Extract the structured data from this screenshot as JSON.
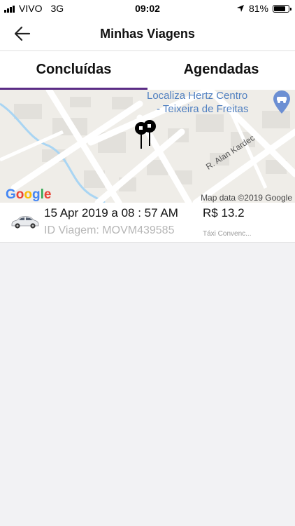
{
  "status_bar": {
    "carrier": "VIVO",
    "network": "3G",
    "time": "09:02",
    "battery": "81%",
    "battery_level": 0.81
  },
  "header": {
    "title": "Minhas Viagens"
  },
  "tabs": [
    {
      "label": "Concluídas",
      "active": true
    },
    {
      "label": "Agendadas",
      "active": false
    }
  ],
  "map": {
    "poi_line1": "Localiza Hertz Centro",
    "poi_line2": "- Teixeira de Freitas",
    "street": "R. Alan Kardec",
    "attribution": "Map data ©2019 Google",
    "logo": "Google"
  },
  "trip": {
    "date": "15 Apr 2019 a 08 : 57 AM",
    "trip_id": "ID Viagem: MOVM439585",
    "price": "R$ 13.2",
    "category": "Táxi Convenc..."
  },
  "colors": {
    "tab_underline": "#5b2c86",
    "poi": "#4f7fc0",
    "river": "#a9d5f3"
  }
}
